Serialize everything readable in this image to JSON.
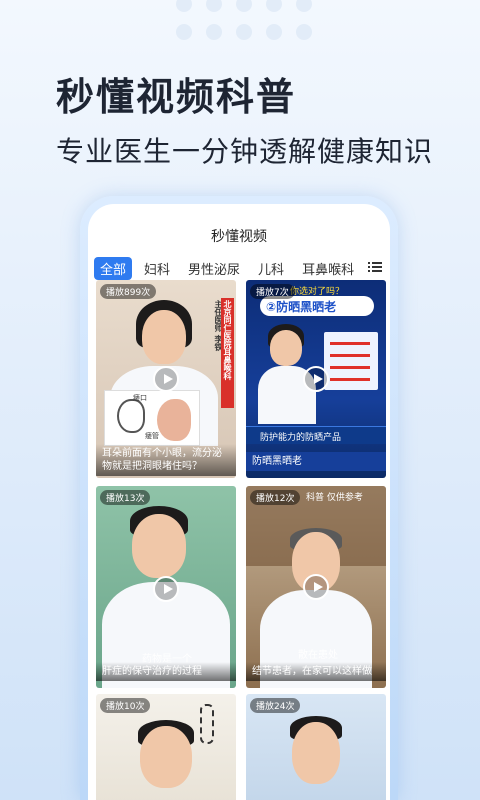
{
  "headline": "秒懂视频科普",
  "subline": "专业医生一分钟透解健康知识",
  "app": {
    "title": "秒懂视频",
    "tabs": [
      "全部",
      "妇科",
      "男性泌尿",
      "儿科",
      "耳鼻喉科"
    ],
    "active_tab": "全部",
    "menu_icon": "list-menu-icon"
  },
  "videos": [
    {
      "views": "播放899次",
      "overlay_lines": [
        "主任医师",
        "李铁"
      ],
      "overlay_hospital": "北京同仁医院耳鼻喉科",
      "inset_labels": [
        "瘘口",
        "瘘管"
      ],
      "caption": "耳朵前面有个小眼，流分泌物就是把洞眼堵住吗？"
    },
    {
      "views": "播放7次",
      "overlay_top": "你选对了吗？",
      "overlay_title": "②防晒黑晒老",
      "overlay_band": "防护能力的防晒产品",
      "caption": "防晒黑晒老"
    },
    {
      "views": "播放13次",
      "overlay_top": "药物是一个",
      "caption": "肝症的保守治疗的过程"
    },
    {
      "views": "播放12次",
      "overlay_top": "科普 仅供参考",
      "overlay_mid": "散在患处",
      "caption": "结节患者，在家可以这样做"
    },
    {
      "views": "播放10次"
    },
    {
      "views": "播放24次"
    }
  ],
  "colors": {
    "accent": "#2f7bf0",
    "overlay_red": "#e0302a",
    "overlay_blue": "#1f52c8"
  }
}
